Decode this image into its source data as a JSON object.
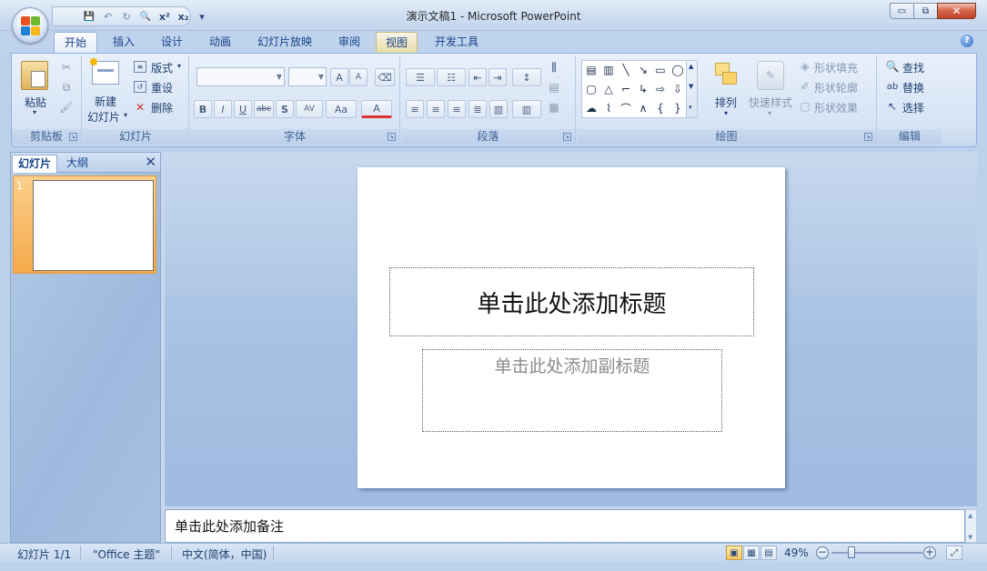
{
  "window": {
    "title": "演示文稿1 - Microsoft PowerPoint",
    "min": "▭",
    "restore": "⧉",
    "close": "✕"
  },
  "qat": {
    "save_icon": "💾",
    "undo_icon": "↶",
    "redo_icon": "↻",
    "preview_icon": "🔍",
    "superscript": "x²",
    "subscript": "x₂",
    "customize": "▾"
  },
  "tabs": [
    "开始",
    "插入",
    "设计",
    "动画",
    "幻灯片放映",
    "审阅",
    "视图",
    "开发工具"
  ],
  "help": "?",
  "ribbon": {
    "clipboard": {
      "label": "剪贴板",
      "paste": "粘贴"
    },
    "slides": {
      "label": "幻灯片",
      "new_line1": "新建",
      "new_line2": "幻灯片",
      "layout": "版式",
      "reset": "重设",
      "delete": "删除"
    },
    "font": {
      "label": "字体",
      "grow": "A",
      "shrink": "A",
      "bold": "B",
      "italic": "I",
      "underline": "U",
      "strike": "abc",
      "shadow": "S",
      "spacing": "AV",
      "case": "Aa",
      "color": "A"
    },
    "paragraph": {
      "label": "段落"
    },
    "drawing": {
      "label": "绘图",
      "arrange": "排列",
      "quick_styles": "快速样式",
      "fill": "形状填充",
      "outline": "形状轮廓",
      "effects": "形状效果"
    },
    "editing": {
      "label": "编辑",
      "find": "查找",
      "replace": "替换",
      "select": "选择"
    }
  },
  "left_pane": {
    "tab_slides": "幻灯片",
    "tab_outline": "大纲",
    "close": "✕",
    "slide_number": "1"
  },
  "slide": {
    "title_placeholder": "单击此处添加标题",
    "subtitle_placeholder": "单击此处添加副标题"
  },
  "notes": {
    "placeholder": "单击此处添加备注"
  },
  "status": {
    "slide_info": "幻灯片 1/1",
    "theme": "\"Office 主题\"",
    "language": "中文(简体，中国)",
    "zoom": "49%",
    "zoom_out": "−",
    "zoom_in": "+"
  }
}
